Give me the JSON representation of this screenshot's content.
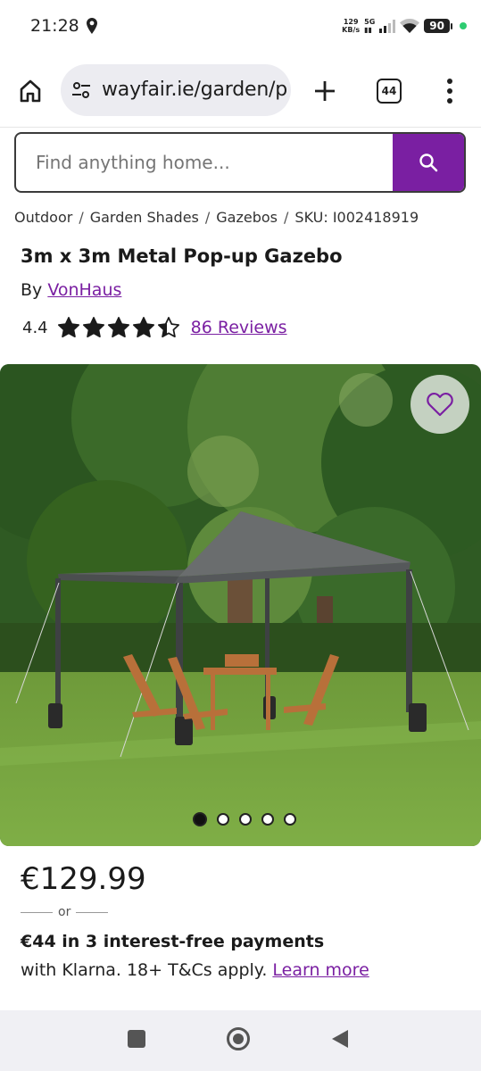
{
  "status_bar": {
    "time": "21:28",
    "net_speed_value": "129",
    "net_speed_unit": "KB/s",
    "network": "5G",
    "battery": "90"
  },
  "browser": {
    "url": "wayfair.ie/garden/p",
    "tab_count": "44"
  },
  "search": {
    "placeholder": "Find anything home..."
  },
  "breadcrumb": {
    "items": [
      "Outdoor",
      "Garden Shades",
      "Gazebos"
    ],
    "sku": "SKU: I002418919"
  },
  "product": {
    "title": "3m x 3m Metal Pop-up Gazebo",
    "by_label": "By",
    "brand": "VonHaus",
    "rating": "4.4",
    "rating_stars": 4.4,
    "reviews": "86 Reviews",
    "image_count": 5,
    "active_image": 1,
    "price": "€129.99",
    "or_label": "or",
    "installment": "€44 in 3 interest-free payments",
    "klarna_text": "with Klarna. 18+ T&Cs apply.",
    "learn_more": "Learn more"
  },
  "colors": {
    "accent": "#7a1fa2",
    "search_button": "#7a1fa2"
  },
  "icons": {
    "home": "home-icon",
    "url_settings": "tune-icon",
    "new_tab": "plus-icon",
    "menu": "more-vert-icon",
    "search": "search-icon",
    "favorite": "heart-icon"
  }
}
